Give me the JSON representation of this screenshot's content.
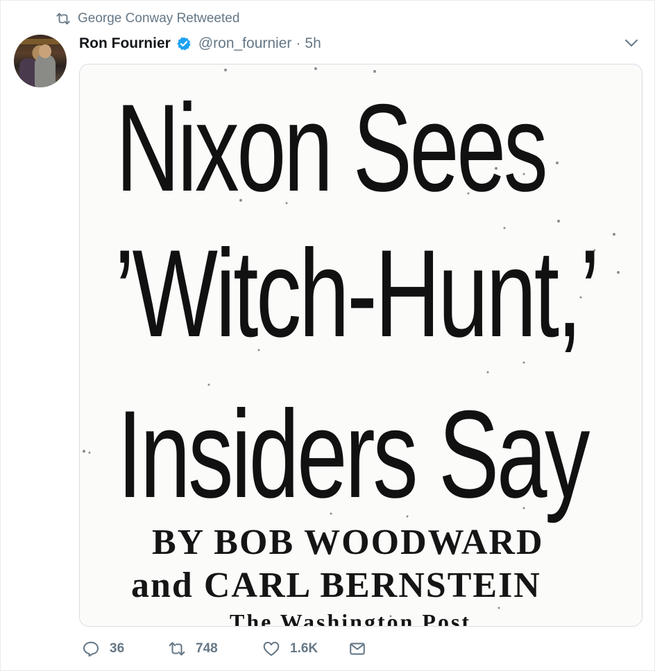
{
  "retweet_context": {
    "text": "George Conway Retweeted",
    "icon": "retweet-icon"
  },
  "tweet": {
    "author_name": "Ron Fournier",
    "verified": true,
    "handle": "@ron_fournier",
    "separator": "·",
    "time": "5h",
    "media": {
      "headline": [
        "Nixon Sees",
        "’Witch-Hunt,’",
        "Insiders Say"
      ],
      "byline": [
        "BY BOB WOODWARD",
        "and CARL BERNSTEIN"
      ],
      "dateline": "The Washington Post"
    },
    "actions": {
      "replies": "36",
      "retweets": "748",
      "likes": "1.6K"
    }
  },
  "colors": {
    "secondary_text": "#657786",
    "verified_blue": "#1da1f2",
    "border": "#e6ecf0"
  }
}
